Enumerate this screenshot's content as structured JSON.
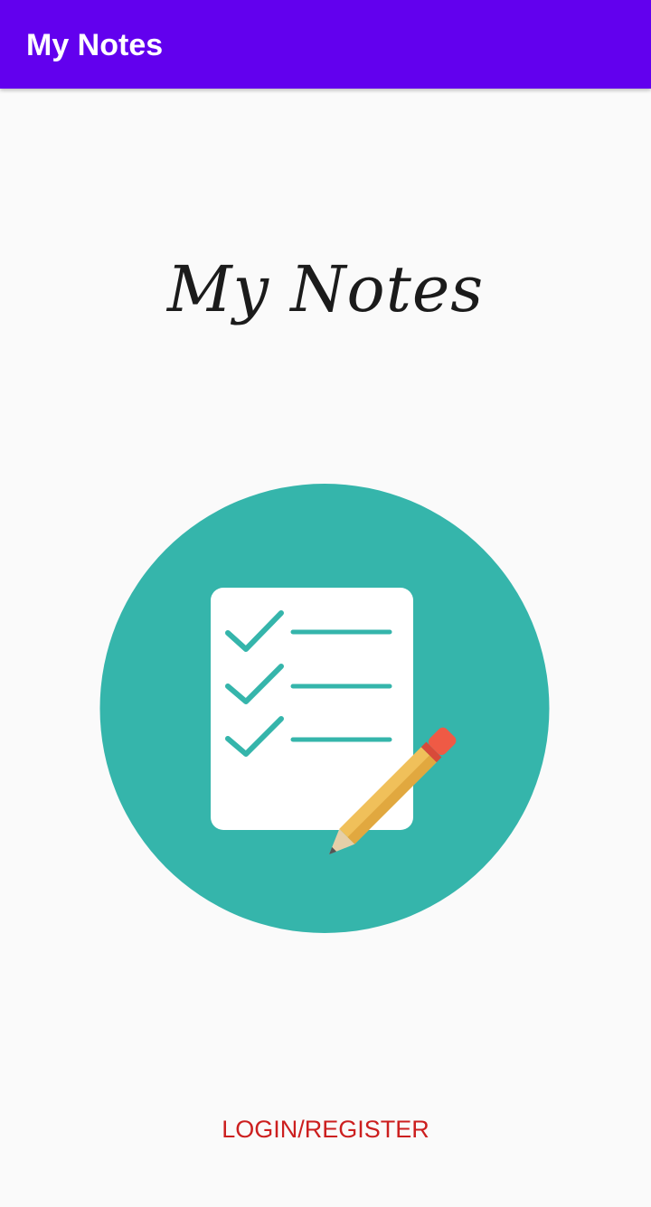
{
  "app_bar": {
    "title": "My Notes",
    "color": "#6200ee"
  },
  "hero": {
    "title": "My Notes"
  },
  "logo": {
    "icon": "checklist-pencil-icon",
    "circle_color": "#35b5ab"
  },
  "actions": {
    "login_register_label": "LOGIN/REGISTER",
    "label_color": "#cc1f1f"
  }
}
